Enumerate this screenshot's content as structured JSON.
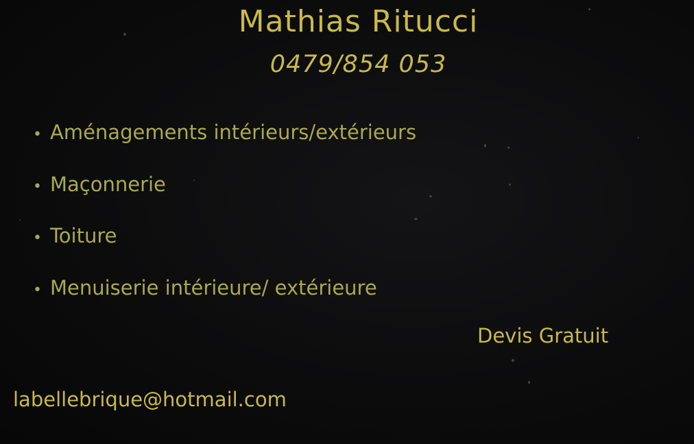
{
  "colors": {
    "background": "#0b0b0c",
    "gold": "#c9b94a",
    "olive": "#a9aa4e"
  },
  "card": {
    "name": "Mathias Ritucci",
    "phone": "0479/854 053",
    "bullet_symbol": "•",
    "services": [
      "Aménagements intérieurs/extérieurs",
      "Maçonnerie",
      "Toiture",
      "Menuiserie intérieure/ extérieure"
    ],
    "quote": "Devis Gratuit",
    "email": "labellebrique@hotmail.com"
  }
}
